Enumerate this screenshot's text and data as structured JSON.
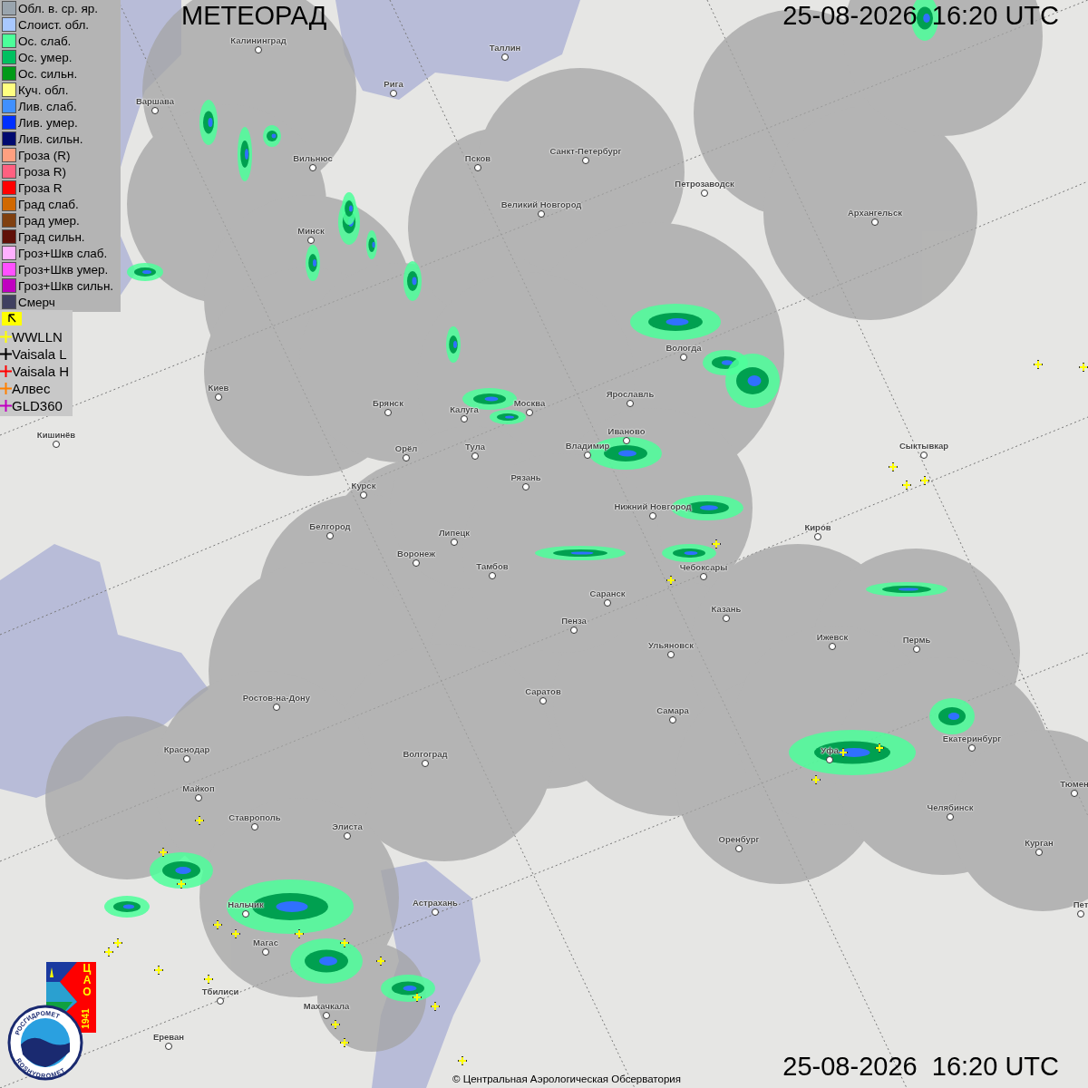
{
  "title": "МЕТЕОРАД",
  "timestamp_top": "25-08-2026  16:20 UTC",
  "legend": {
    "items": [
      {
        "label": "Обл. в. ср. яр.",
        "color": "#9aa5ae"
      },
      {
        "label": "Слоист. обл.",
        "color": "#a8c8ff"
      },
      {
        "label": "Ос. слаб.",
        "color": "#4cff9a"
      },
      {
        "label": "Ос. умер.",
        "color": "#00c060"
      },
      {
        "label": "Ос. сильн.",
        "color": "#009a18"
      },
      {
        "label": "Куч. обл.",
        "color": "#ffff80"
      },
      {
        "label": "Лив. слаб.",
        "color": "#4090ff"
      },
      {
        "label": "Лив. умер.",
        "color": "#0030ff"
      },
      {
        "label": "Лив. сильн.",
        "color": "#000a70"
      },
      {
        "label": "Гроза (R)",
        "color": "#ffa080"
      },
      {
        "label": "Гроза R)",
        "color": "#ff6080"
      },
      {
        "label": "Гроза R",
        "color": "#ff0000"
      },
      {
        "label": "Град слаб.",
        "color": "#d06800"
      },
      {
        "label": "Град умер.",
        "color": "#804010"
      },
      {
        "label": "Град сильн.",
        "color": "#601008"
      },
      {
        "label": "Гроз+Шкв слаб.",
        "color": "#ffb0ff"
      },
      {
        "label": "Гроз+Шкв умер.",
        "color": "#ff50ff"
      },
      {
        "label": "Гроз+Шкв сильн.",
        "color": "#c000c0"
      },
      {
        "label": "Смерч",
        "color": "#404060"
      }
    ]
  },
  "lightning_legend": [
    {
      "label": "WWLLN",
      "color": "#ffff00"
    },
    {
      "label": "Vaisala L",
      "color": "#000000"
    },
    {
      "label": "Vaisala H",
      "color": "#ff0000"
    },
    {
      "label": "Алвес",
      "color": "#ff8000"
    },
    {
      "label": "GLD360",
      "color": "#c000c0"
    }
  ],
  "cities": [
    "Калининград",
    "Рига",
    "Таллин",
    "Варшава",
    "Вильнюс",
    "Псков",
    "Санкт-Петербург",
    "Петрозаводск",
    "Великий Новгород",
    "Архангельск",
    "Минск",
    "Вологда",
    "Киев",
    "Брянск",
    "Калуга",
    "Москва",
    "Ярославль",
    "Иваново",
    "Тула",
    "Владимир",
    "Кишинёв",
    "Орёл",
    "Рязань",
    "Сыктывкар",
    "Курск",
    "Нижний Новгород",
    "Белгород",
    "Киров",
    "Липецк",
    "Воронеж",
    "Тамбов",
    "Чебоксары",
    "Саранск",
    "Казань",
    "Пенза",
    "Ижевск",
    "Пермь",
    "Ульяновск",
    "Саратов",
    "Ростов-на-Дону",
    "Самара",
    "Краснодар",
    "Волгоград",
    "Уфа",
    "Екатеринбург",
    "Тюмен",
    "Майкоп",
    "Ставрополь",
    "Элиста",
    "Оренбург",
    "Челябинск",
    "Курган",
    "Нальчик",
    "Астрахань",
    "Магас",
    "Махачкала",
    "Тбилиси",
    "Ереван",
    "Пет"
  ],
  "logos": {
    "emblem_letters": "ЦАО",
    "emblem_year": "1941",
    "agency_ru": "РОСГИДРОМЕТ",
    "agency_en": "ROSHYDROMET"
  },
  "copyright": "© Центральная Аэрологическая Обсерватория",
  "timestamp_bottom": "25-08-2026  16:20 UTC"
}
